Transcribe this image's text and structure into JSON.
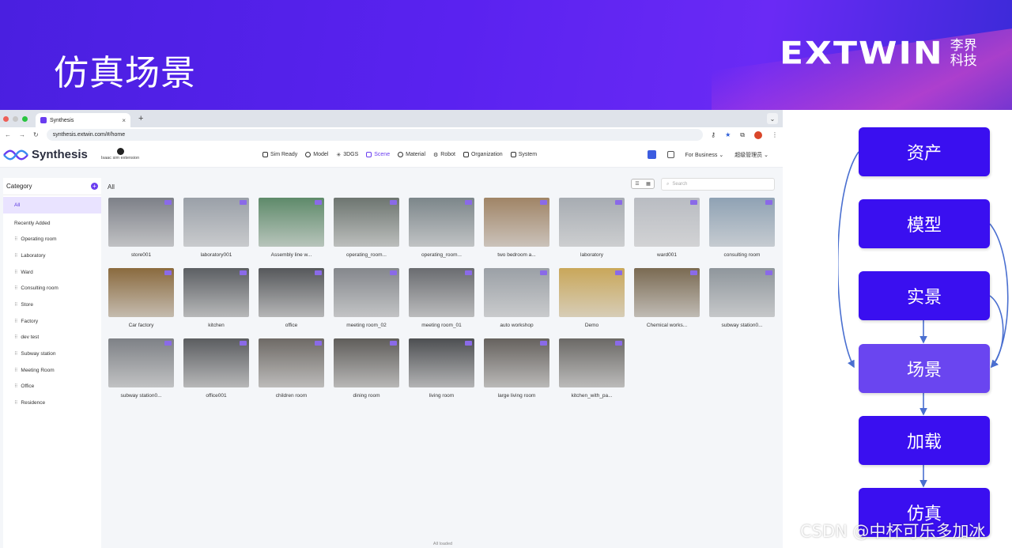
{
  "slide": {
    "title": "仿真场景",
    "logo_word": "EXTWIN",
    "logo_cn": "李界科技"
  },
  "browser": {
    "tab_title": "Synthesis",
    "tab_close": "×",
    "new_tab": "+",
    "url": "synthesis.extwin.com/#/home"
  },
  "app": {
    "brand": "Synthesis",
    "isaac": "Isaac sim extension",
    "nav": [
      "Sim Ready",
      "Model",
      "3DGS",
      "Scene",
      "Material",
      "Robot",
      "Organization",
      "System"
    ],
    "active_nav": "Scene",
    "for_business": "For Business",
    "admin": "超级管理员"
  },
  "sidebar": {
    "header": "Category",
    "items": [
      "All",
      "Recently Added",
      "Operating room",
      "Laboratory",
      "Ward",
      "Consulting room",
      "Store",
      "Factory",
      "dev test",
      "Subway station",
      "Meeting Room",
      "Office",
      "Residence"
    ]
  },
  "main": {
    "heading": "All",
    "search_placeholder": "Search",
    "footer": "All loaded",
    "cards": [
      {
        "label": "store001",
        "color": "#7d8088"
      },
      {
        "label": "laboratory001",
        "color": "#9aa0a8"
      },
      {
        "label": "Assembly line w...",
        "color": "#5e8a6a"
      },
      {
        "label": "operating_room...",
        "color": "#6d7570"
      },
      {
        "label": "operating_room...",
        "color": "#7c868a"
      },
      {
        "label": "two bedroom a...",
        "color": "#a08466"
      },
      {
        "label": "laboratory",
        "color": "#a7acb2"
      },
      {
        "label": "ward001",
        "color": "#b9bcc2"
      },
      {
        "label": "consulting room",
        "color": "#8fa2b4"
      },
      {
        "label": "Car factory",
        "color": "#8a6a3e"
      },
      {
        "label": "kitchen",
        "color": "#5c5f63"
      },
      {
        "label": "office",
        "color": "#56585b"
      },
      {
        "label": "meeting room_02",
        "color": "#84878c"
      },
      {
        "label": "meeting room_01",
        "color": "#6a6c70"
      },
      {
        "label": "auto workshop",
        "color": "#9ba0a6"
      },
      {
        "label": "Demo",
        "color": "#c9a75a"
      },
      {
        "label": "Chemical works...",
        "color": "#7a6a52"
      },
      {
        "label": "subway station0...",
        "color": "#8f969c"
      },
      {
        "label": "subway station0...",
        "color": "#7e8186"
      },
      {
        "label": "office001",
        "color": "#5b5d60"
      },
      {
        "label": "children room",
        "color": "#6e6a66"
      },
      {
        "label": "dining room",
        "color": "#5f5d5a"
      },
      {
        "label": "living room",
        "color": "#4d4f52"
      },
      {
        "label": "large living room",
        "color": "#66625e"
      },
      {
        "label": "kitchen_with_pa...",
        "color": "#6b6966"
      }
    ]
  },
  "flow": {
    "nodes": [
      "资产",
      "模型",
      "实景",
      "场景",
      "加载",
      "仿真"
    ]
  },
  "watermark": "CSDN @中杯可乐多加冰"
}
